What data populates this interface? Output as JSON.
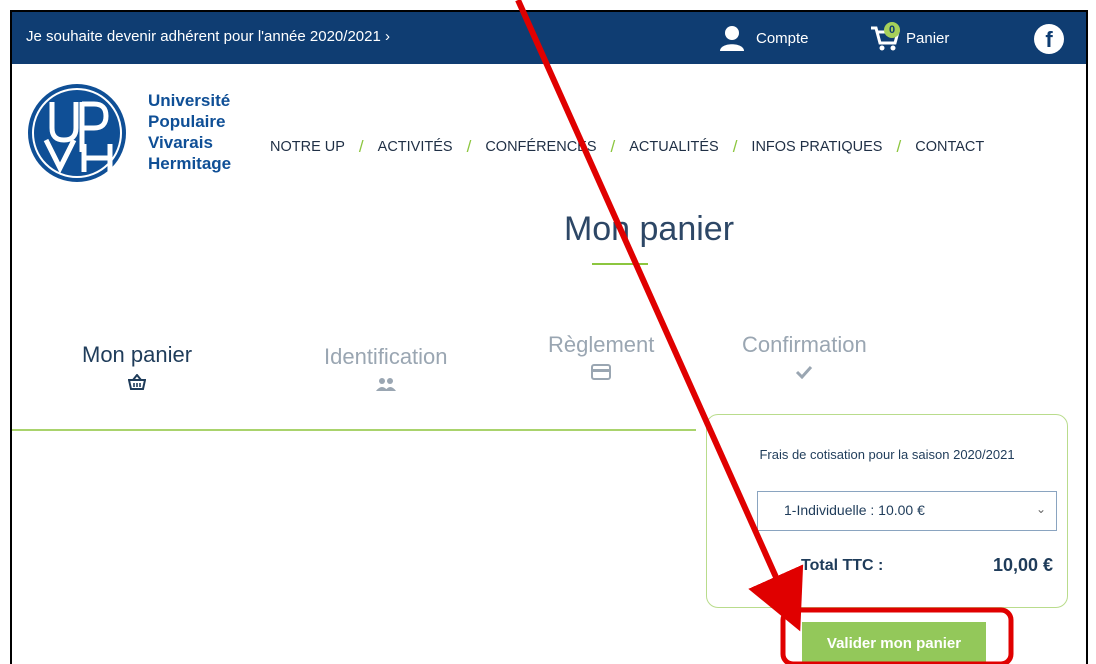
{
  "topbar": {
    "promo": "Je souhaite devenir adhérent pour l'année 2020/2021 ›",
    "account_label": "Compte",
    "cart_label": "Panier",
    "cart_count": "0",
    "facebook_glyph": "f"
  },
  "brand": {
    "line1": "Université",
    "line2": "Populaire",
    "line3": "Vivarais",
    "line4": "Hermitage"
  },
  "nav": {
    "items": [
      "NOTRE UP",
      "ACTIVITÉS",
      "CONFÉRENCES",
      "ACTUALITÉS",
      "INFOS PRATIQUES",
      "CONTACT"
    ]
  },
  "page": {
    "title": "Mon panier"
  },
  "steps": [
    {
      "label": "Mon panier",
      "icon": "basket-icon",
      "active": true
    },
    {
      "label": "Identification",
      "icon": "users-icon",
      "active": false
    },
    {
      "label": "Règlement",
      "icon": "credit-card-icon",
      "active": false
    },
    {
      "label": "Confirmation",
      "icon": "check-icon",
      "active": false
    }
  ],
  "summary": {
    "fee_label": "Frais de cotisation pour la saison 2020/2021",
    "selected_option": "1-Individuelle : 10.00 €",
    "total_label": "Total TTC :",
    "total_value": "10,00 €"
  },
  "actions": {
    "validate_label": "Valider mon panier"
  },
  "colors": {
    "topbar": "#0f3d72",
    "accent_green": "#8cc63f",
    "button_green": "#93c85a",
    "annotation_red": "#e00000"
  }
}
